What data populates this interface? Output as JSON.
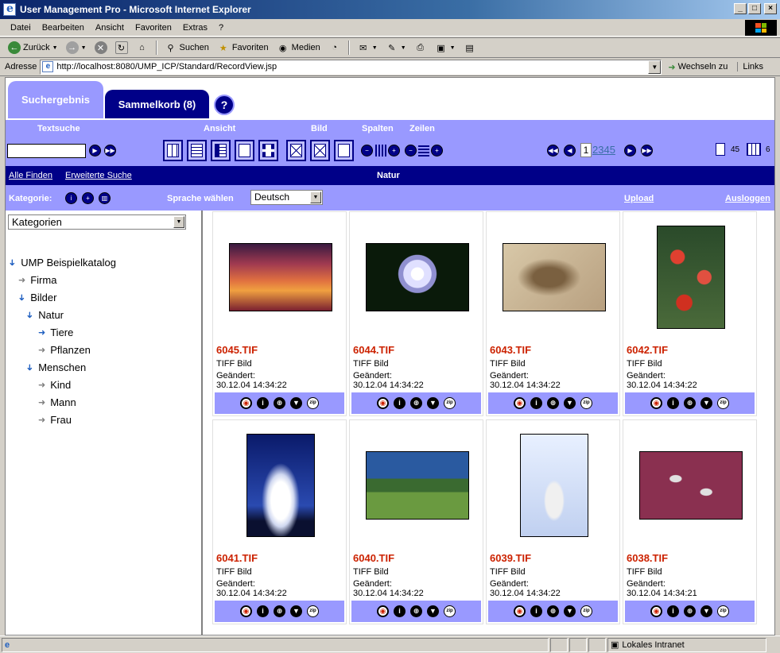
{
  "window": {
    "title": "User Management Pro - Microsoft Internet Explorer"
  },
  "menu": [
    "Datei",
    "Bearbeiten",
    "Ansicht",
    "Favoriten",
    "Extras",
    "?"
  ],
  "toolbar": {
    "back": "Zurück",
    "search": "Suchen",
    "favorites": "Favoriten",
    "media": "Medien"
  },
  "address": {
    "label": "Adresse",
    "url": "http://localhost:8080/UMP_ICP/Standard/RecordView.jsp",
    "go": "Wechseln zu",
    "links": "Links"
  },
  "tabs": {
    "active": "Suchergebnis",
    "inactive": "Sammelkorb (8)",
    "help": "?"
  },
  "controls": {
    "textsuche": "Textsuche",
    "ansicht": "Ansicht",
    "bild": "Bild",
    "spalten": "Spalten",
    "zeilen": "Zeilen",
    "page_current": "1",
    "page_links": "2345",
    "total_count": "45",
    "grid_count": "6"
  },
  "nav": {
    "find_all": "Alle Finden",
    "advanced": "Erweiterte Suche",
    "breadcrumb": "Natur"
  },
  "catbar": {
    "kategorie": "Kategorie:",
    "sprache": "Sprache wählen",
    "language": "Deutsch",
    "upload": "Upload",
    "logout": "Ausloggen"
  },
  "sidebar": {
    "select": "Kategorien",
    "tree": [
      {
        "label": "UMP Beispielkatalog",
        "level": 0,
        "expanded": true
      },
      {
        "label": "Firma",
        "level": 1,
        "expanded": false
      },
      {
        "label": "Bilder",
        "level": 1,
        "expanded": true
      },
      {
        "label": "Natur",
        "level": 2,
        "expanded": true
      },
      {
        "label": "Tiere",
        "level": 3,
        "expanded": false
      },
      {
        "label": "Pflanzen",
        "level": 3,
        "expanded": false
      },
      {
        "label": "Menschen",
        "level": 2,
        "expanded": true
      },
      {
        "label": "Kind",
        "level": 3,
        "expanded": false
      },
      {
        "label": "Mann",
        "level": 3,
        "expanded": false
      },
      {
        "label": "Frau",
        "level": 3,
        "expanded": false
      }
    ]
  },
  "records": [
    {
      "name": "6045.TIF",
      "type": "TIFF Bild",
      "modified_label": "Geändert:",
      "modified": "30.12.04 14:34:22",
      "image": "sunset"
    },
    {
      "name": "6044.TIF",
      "type": "TIFF Bild",
      "modified_label": "Geändert:",
      "modified": "30.12.04 14:34:22",
      "image": "columbine"
    },
    {
      "name": "6043.TIF",
      "type": "TIFF Bild",
      "modified_label": "Geändert:",
      "modified": "30.12.04 14:34:22",
      "image": "fossil"
    },
    {
      "name": "6042.TIF",
      "type": "TIFF Bild",
      "modified_label": "Geändert:",
      "modified": "30.12.04 14:34:22",
      "image": "red-leaves"
    },
    {
      "name": "6041.TIF",
      "type": "TIFF Bild",
      "modified_label": "Geändert:",
      "modified": "30.12.04 14:34:22",
      "image": "clouds"
    },
    {
      "name": "6040.TIF",
      "type": "TIFF Bild",
      "modified_label": "Geändert:",
      "modified": "30.12.04 14:34:22",
      "image": "deer"
    },
    {
      "name": "6039.TIF",
      "type": "TIFF Bild",
      "modified_label": "Geändert:",
      "modified": "30.12.04 14:34:22",
      "image": "seal"
    },
    {
      "name": "6038.TIF",
      "type": "TIFF Bild",
      "modified_label": "Geändert:",
      "modified": "30.12.04 14:34:21",
      "image": "shrimp"
    }
  ],
  "status": {
    "zone": "Lokales Intranet"
  },
  "colors": {
    "accent": "#9999ff",
    "dark": "#000088",
    "filename": "#cc2200"
  }
}
